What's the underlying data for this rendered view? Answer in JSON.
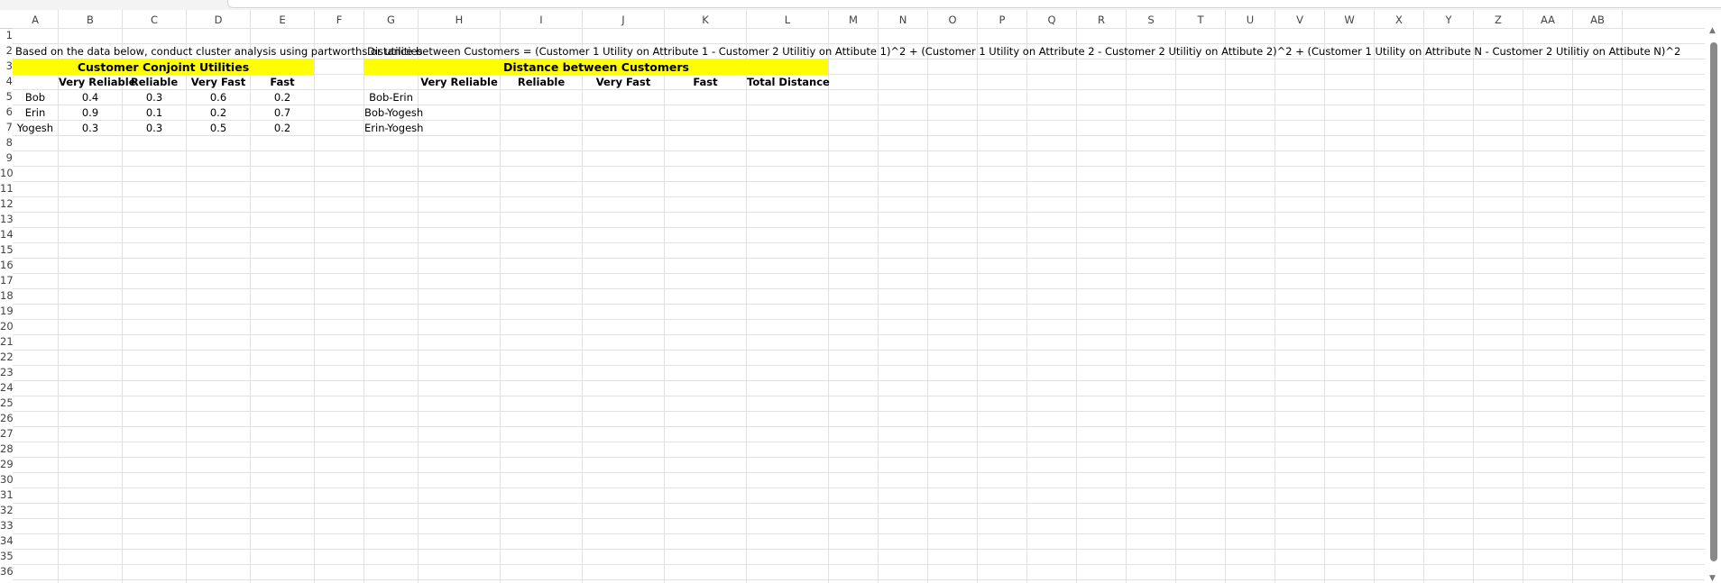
{
  "columns": [
    "A",
    "B",
    "C",
    "D",
    "E",
    "F",
    "G",
    "H",
    "I",
    "J",
    "K",
    "L",
    "M",
    "N",
    "O",
    "P",
    "Q",
    "R",
    "S",
    "T",
    "U",
    "V",
    "W",
    "X",
    "Y",
    "Z",
    "AA",
    "AB"
  ],
  "rows": [
    "1",
    "2",
    "3",
    "4",
    "5",
    "6",
    "7",
    "8",
    "9",
    "10",
    "11",
    "12",
    "13",
    "14",
    "15",
    "16",
    "17",
    "18",
    "19",
    "20",
    "21",
    "22",
    "23",
    "24",
    "25",
    "26",
    "27",
    "28",
    "29",
    "30",
    "31",
    "32",
    "33",
    "34",
    "35",
    "36"
  ],
  "row2": {
    "intro": "Based on the data below, conduct cluster analysis using partworths or utilities.",
    "formula": "Distance between Customers = (Customer 1 Utility on Attribute 1 - Customer 2 Utilitiy on Attibute 1)^2 +  (Customer 1 Utility on Attribute 2 - Customer 2 Utilitiy on Attibute 2)^2 +  (Customer 1 Utility on Attribute N - Customer 2 Utilitiy on Attibute N)^2"
  },
  "left_table": {
    "title": "Customer Conjoint Utilities",
    "headers": [
      "Very Reliable",
      "Reliable",
      "Very Fast",
      "Fast"
    ],
    "rows": [
      {
        "name": "Bob",
        "values": [
          "0.4",
          "0.3",
          "0.6",
          "0.2"
        ]
      },
      {
        "name": "Erin",
        "values": [
          "0.9",
          "0.1",
          "0.2",
          "0.7"
        ]
      },
      {
        "name": "Yogesh",
        "values": [
          "0.3",
          "0.3",
          "0.5",
          "0.2"
        ]
      }
    ]
  },
  "right_table": {
    "title": "Distance between Customers",
    "headers": [
      "Very Reliable",
      "Reliable",
      "Very Fast",
      "Fast",
      "Total Distance"
    ],
    "pairs": [
      "Bob-Erin",
      "Bob-Yogesh",
      "Erin-Yogesh"
    ]
  },
  "scrollbar": {
    "up": "▲",
    "down": "▼"
  }
}
